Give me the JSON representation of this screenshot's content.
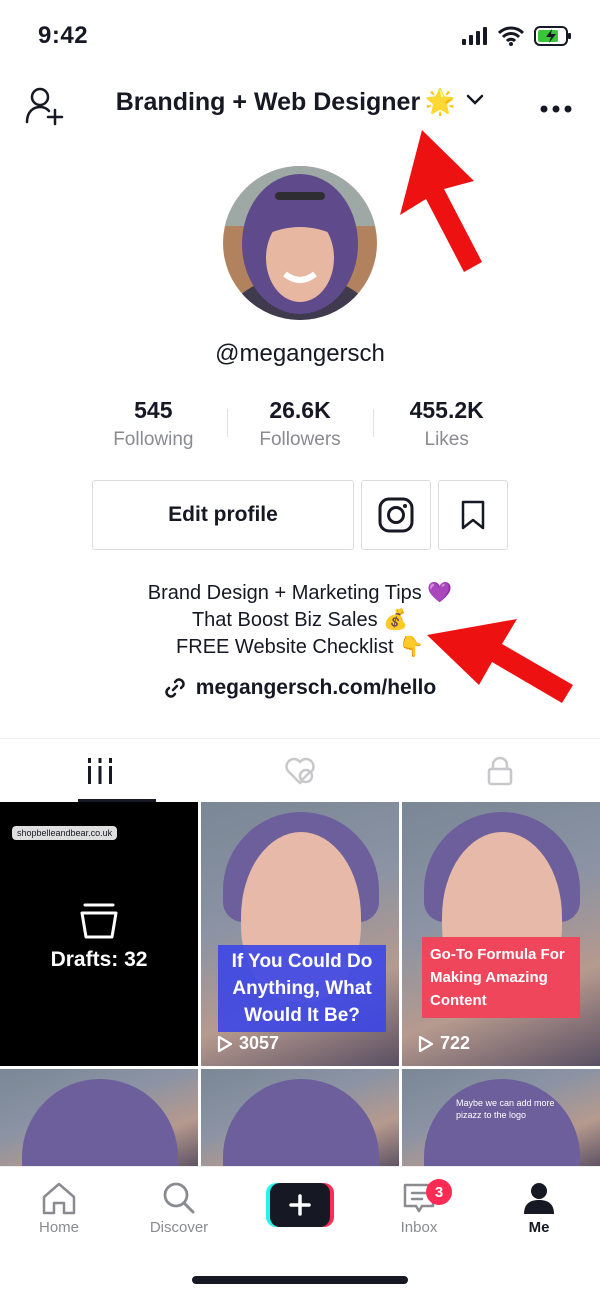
{
  "status": {
    "time": "9:42"
  },
  "header": {
    "title": "Branding + Web Designer",
    "title_emoji": "🌟"
  },
  "profile": {
    "username": "@megangersch",
    "stats": [
      {
        "value": "545",
        "label": "Following"
      },
      {
        "value": "26.6K",
        "label": "Followers"
      },
      {
        "value": "455.2K",
        "label": "Likes"
      }
    ],
    "edit_label": "Edit profile",
    "bio": [
      "Brand Design + Marketing Tips 💜",
      "That Boost Biz Sales 💰",
      "FREE Website Checklist 👇"
    ],
    "link": "megangersch.com/hello"
  },
  "grid": {
    "drafts_label": "Drafts: 32",
    "drafts_comment": "shopbelleandbear.co.uk",
    "video2_caption": "If You Could Do Anything, What Would It Be?",
    "video2_views": "3057",
    "video3_caption": "Go-To Formula For Making Amazing Content",
    "video3_views": "722",
    "video6_comment": "Maybe we can add more pizazz to the logo"
  },
  "nav": {
    "home": "Home",
    "discover": "Discover",
    "inbox": "Inbox",
    "inbox_badge": "3",
    "me": "Me"
  },
  "colors": {
    "accent_red": "#fe2c55",
    "arrow_red": "#ee1111",
    "text": "#161823",
    "muted": "#8a8b91"
  }
}
